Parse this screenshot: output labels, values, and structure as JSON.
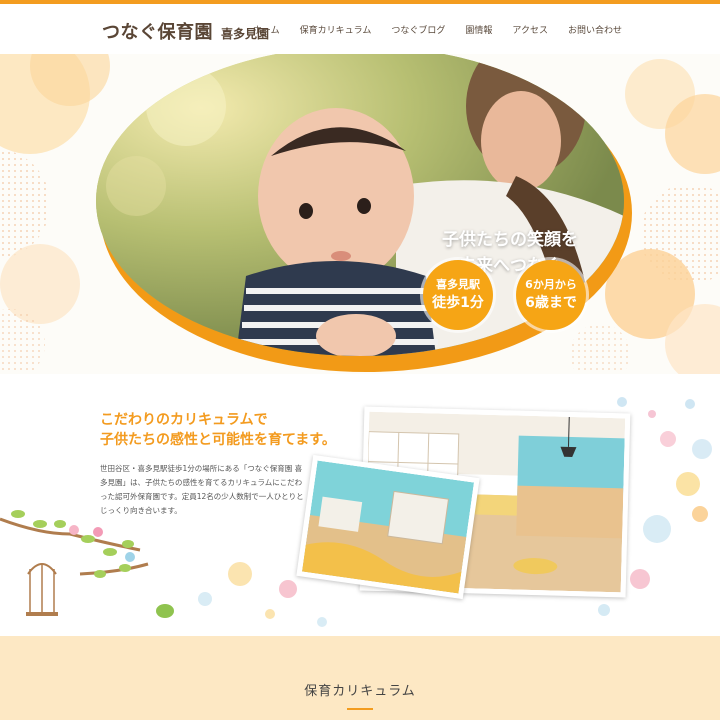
{
  "header": {
    "logo_main": "つなぐ保育園",
    "logo_sub": "喜多見園",
    "nav": [
      "ホーム",
      "保育カリキュラム",
      "つなぐブログ",
      "園情報",
      "アクセス",
      "お問い合わせ"
    ]
  },
  "hero": {
    "catch_line1": "子供たちの笑顔を",
    "catch_line2": "未来へつなぐ",
    "badge1_line1": "喜多見駅",
    "badge1_line2": "徒歩1分",
    "badge2_line1": "6か月から",
    "badge2_line2": "6歳まで"
  },
  "intro": {
    "lead_line1": "こだわりのカリキュラムで",
    "lead_line2": "子供たちの感性と可能性を育てます。",
    "body": "世田谷区・喜多見駅徒歩1分の場所にある「つなぐ保育園 喜多見園」は、子供たちの感性を育てるカリキュラムにこだわった認可外保育園です。定員12名の少人数制で一人ひとりとじっくり向き合います。"
  },
  "section_curriculum": {
    "title": "保育カリキュラム"
  },
  "colors": {
    "accent": "#f39c1f",
    "brown": "#5a4636",
    "cream": "#fde8c4"
  }
}
